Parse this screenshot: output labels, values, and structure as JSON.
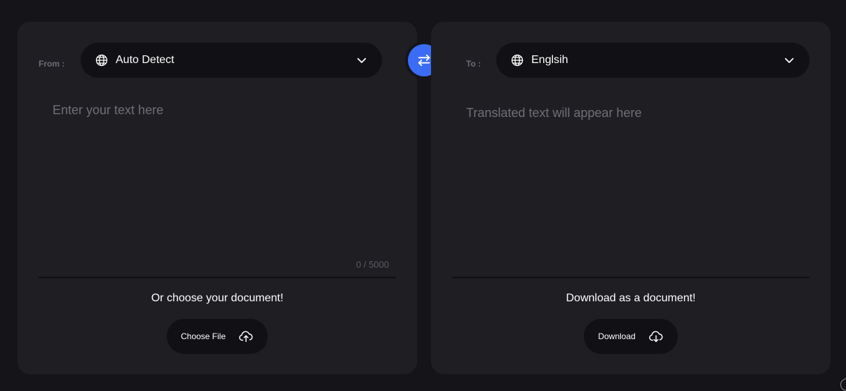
{
  "source": {
    "label": "From :",
    "language": "Auto Detect",
    "input_placeholder": "Enter your text here",
    "input_value": "",
    "char_count": "0 / 5000",
    "doc_caption": "Or choose your document!",
    "choose_file_label": "Choose File"
  },
  "target": {
    "label": "To :",
    "language": "Englsih",
    "output_placeholder": "Translated text will appear here",
    "doc_caption": "Download as a document!",
    "download_label": "Download"
  },
  "colors": {
    "background": "#141419",
    "panel": "#1e1e23",
    "control": "#111115",
    "accent": "#3b6cf5"
  },
  "icons": {
    "language": "globe-icon",
    "dropdown": "chevron-down-icon",
    "swap": "swap-arrows-icon",
    "upload": "cloud-upload-icon",
    "download": "cloud-download-icon"
  }
}
